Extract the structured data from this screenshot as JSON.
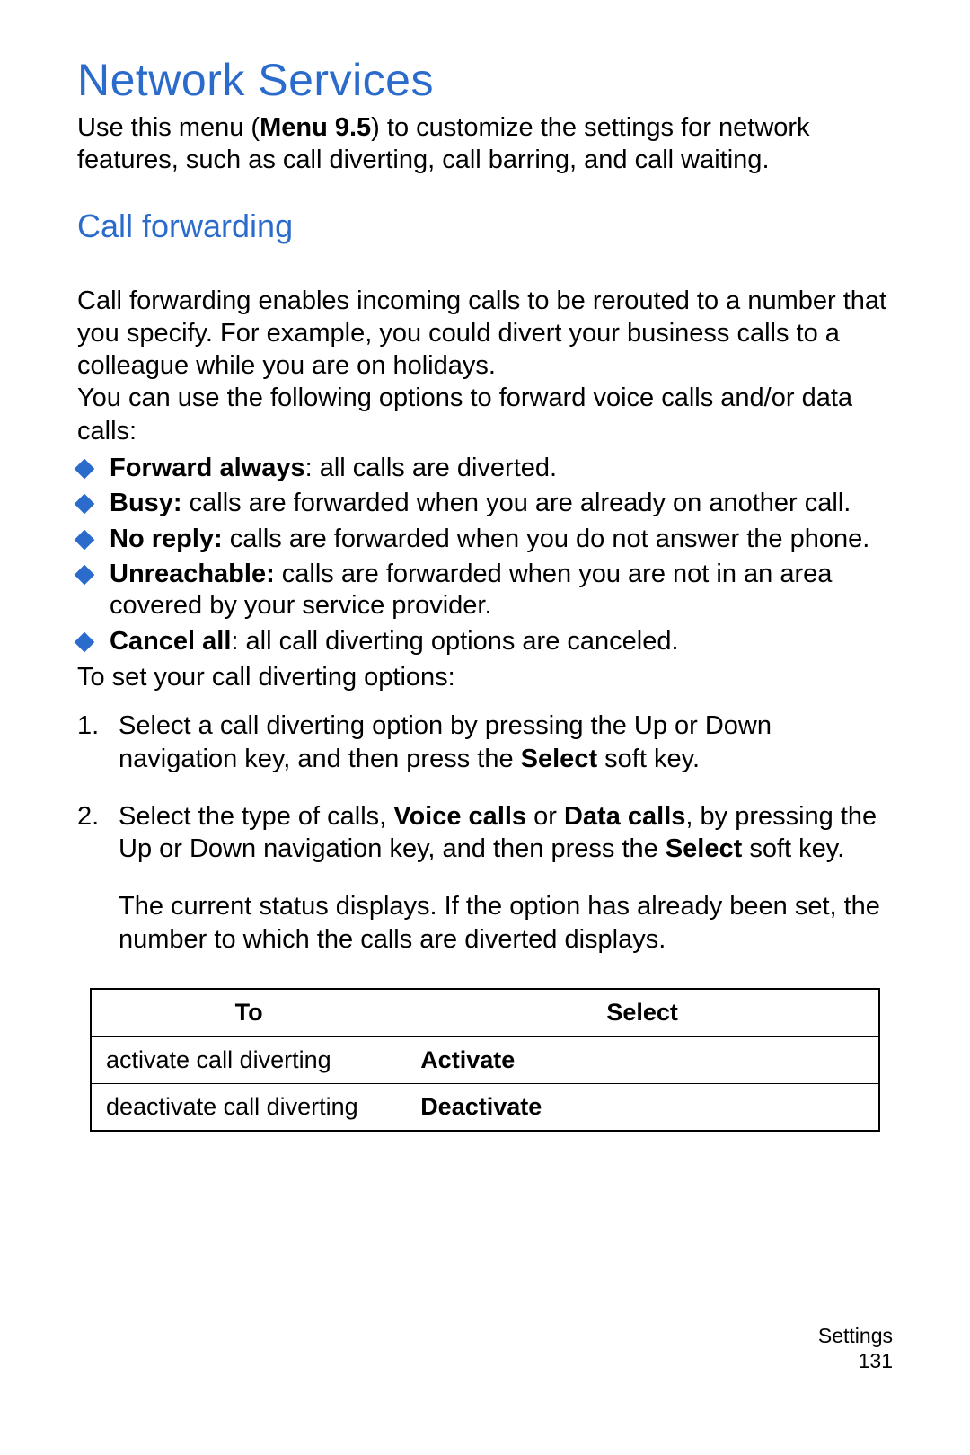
{
  "h1": "Network Services",
  "intro": {
    "pre": "Use this menu (",
    "menu": "Menu 9.5",
    "post": ") to customize the settings for network features, such as call diverting, call barring, and call waiting."
  },
  "h2": "Call forwarding",
  "para1": "Call forwarding enables incoming calls to be rerouted to a number that you specify. For example, you could divert your business calls to a colleague while you are on holidays.",
  "para2": "You can use the following options to forward voice calls and/or data calls:",
  "bullets": [
    {
      "term": "Forward always",
      "sep": ": ",
      "desc": "all calls are diverted."
    },
    {
      "term": "Busy:",
      "sep": " ",
      "desc": "calls are forwarded when you are already on another call."
    },
    {
      "term": "No reply:",
      "sep": " ",
      "desc": "calls are forwarded when you do not answer the phone."
    },
    {
      "term": "Unreachable:",
      "sep": " ",
      "desc": "calls are forwarded when you are not in an area covered by your service provider."
    },
    {
      "term": "Cancel all",
      "sep": ": ",
      "desc": "all call diverting options are canceled."
    }
  ],
  "para3": "To set your call diverting options:",
  "steps": {
    "s1": {
      "marker": "1.",
      "a": "Select a call diverting option by pressing the Up or Down navigation key, and then press the ",
      "b": "Select",
      "c": " soft key."
    },
    "s2": {
      "marker": "2.",
      "a": "Select the type of calls, ",
      "b": "Voice calls",
      "c": " or ",
      "d": "Data calls",
      "e": ", by pressing the Up or Down navigation key, and then press the ",
      "f": "Select",
      "g": " soft key.",
      "sub": "The current status displays. If the option has already been set, the number to which the calls are diverted displays."
    }
  },
  "table": {
    "hdr_to": "To",
    "hdr_select": "Select",
    "rows": [
      {
        "to": "activate call diverting",
        "select": "Activate"
      },
      {
        "to": "deactivate call diverting",
        "select": "Deactivate"
      }
    ]
  },
  "footer": {
    "section": "Settings",
    "page": "131"
  }
}
